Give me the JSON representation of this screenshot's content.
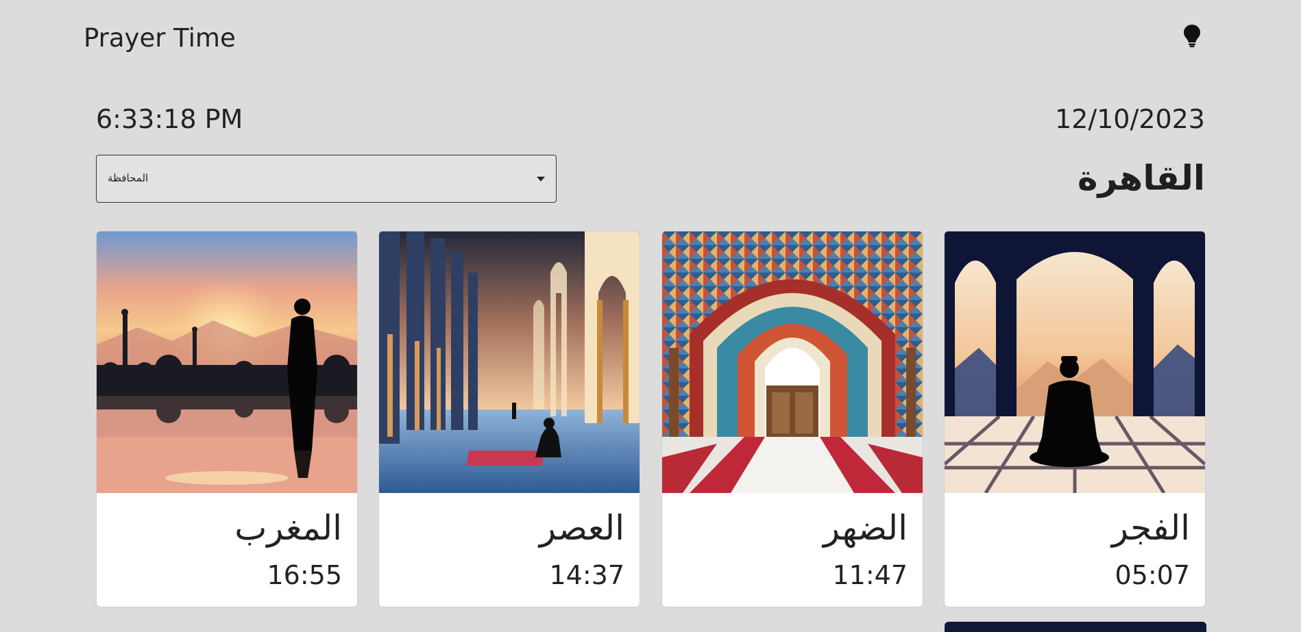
{
  "navbar": {
    "brand": "Prayer Time",
    "theme_icon": "lightbulb-icon"
  },
  "clock": {
    "time": "6:33:18 PM",
    "date": "12/10/2023"
  },
  "governorate_select": {
    "selected_label": "المحافظة"
  },
  "city": "القاهرة",
  "prayers": [
    {
      "name": "المغرب",
      "time": "16:55",
      "image": "sunset-mosque-reflection"
    },
    {
      "name": "العصر",
      "time": "14:37",
      "image": "mosque-colonnade"
    },
    {
      "name": "الضهر",
      "time": "11:47",
      "image": "mosque-arch-door"
    },
    {
      "name": "الفجر",
      "time": "05:07",
      "image": "praying-silhouette-window"
    }
  ],
  "colors": {
    "background": "#dcdcdc",
    "card": "#ffffff",
    "text": "#1f1f1f"
  }
}
